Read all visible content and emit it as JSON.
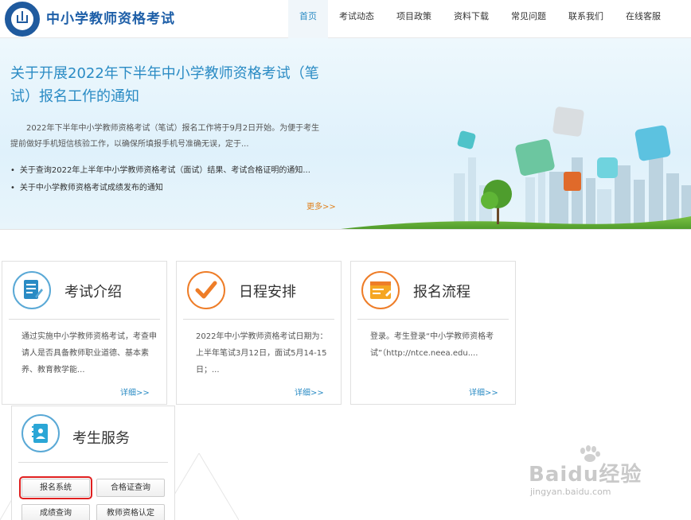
{
  "header": {
    "site_title": "中小学教师资格考试",
    "nav": [
      "首页",
      "考试动态",
      "项目政策",
      "资料下载",
      "常见问题",
      "联系我们",
      "在线客服"
    ]
  },
  "banner": {
    "title": "关于开展2022年下半年中小学教师资格考试（笔试）报名工作的通知",
    "desc": "2022年下半年中小学教师资格考试（笔试）报名工作将于9月2日开始。为便于考生提前做好手机短信核验工作，以确保所填报手机号准确无误，定于...",
    "news": [
      "关于查询2022年上半年中小学教师资格考试（面试）结果、考试合格证明的通知...",
      "关于中小学教师资格考试成绩发布的通知"
    ],
    "more": "更多>>"
  },
  "cards": [
    {
      "title": "考试介绍",
      "text": "通过实施中小学教师资格考试，考查申请人是否具备教师职业道德、基本素养、教育教学能...",
      "more": "详细>>"
    },
    {
      "title": "日程安排",
      "text": "2022年中小学教师资格考试日期为：上半年笔试3月12日，面试5月14-15日；...",
      "more": "详细>>"
    },
    {
      "title": "报名流程",
      "text": "登录。考生登录“中小学教师资格考试”（http://ntce.neea.edu....",
      "more": "详细>>"
    }
  ],
  "service": {
    "title": "考生服务",
    "buttons": [
      "报名系统",
      "合格证查询",
      "成绩查询",
      "教师资格认定"
    ]
  },
  "watermark": {
    "brand": "Baidu经验",
    "url": "jingyan.baidu.com"
  },
  "colors": {
    "accent": "#2a8bc4",
    "title_blue": "#1e5fa8",
    "orange": "#ee7d28",
    "highlight": "#e02020"
  }
}
